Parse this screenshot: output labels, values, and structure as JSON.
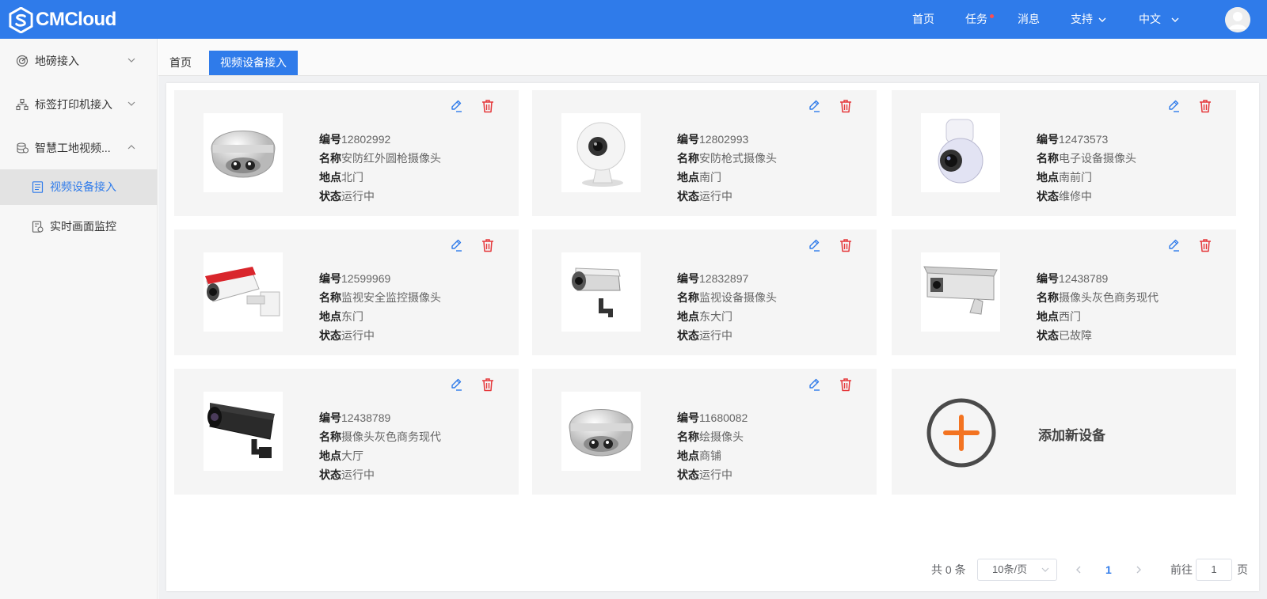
{
  "brand": {
    "name": "CMCloud"
  },
  "topnav": {
    "home": "首页",
    "tasks": "任务",
    "messages": "消息",
    "support": "支持",
    "language": "中文"
  },
  "sidebar": {
    "items": [
      {
        "label": "地磅接入",
        "icon": "radar-icon",
        "expanded": false
      },
      {
        "label": "标签打印机接入",
        "icon": "sitemap-icon",
        "expanded": false
      },
      {
        "label": "智慧工地视频...",
        "icon": "coins-icon",
        "expanded": true
      }
    ],
    "subitems": [
      {
        "label": "视频设备接入",
        "icon": "document-icon",
        "active": true
      },
      {
        "label": "实时画面监控",
        "icon": "monitor-doc-icon",
        "active": false
      }
    ]
  },
  "tabs": [
    {
      "label": "首页",
      "active": false
    },
    {
      "label": "视频设备接入",
      "active": true
    }
  ],
  "field_labels": {
    "id": "编号",
    "name": "名称",
    "location": "地点",
    "status": "状态"
  },
  "devices": [
    {
      "id": "12802992",
      "name": "安防红外圆枪摄像头",
      "location": "北门",
      "status": "运行中",
      "camera": "dome"
    },
    {
      "id": "12802993",
      "name": "安防枪式摄像头",
      "location": "南门",
      "status": "运行中",
      "camera": "webcam"
    },
    {
      "id": "12473573",
      "name": "电子设备摄像头",
      "location": "南前门",
      "status": "维修中",
      "camera": "ptz"
    },
    {
      "id": "12599969",
      "name": "监视安全监控摄像头",
      "location": "东门",
      "status": "运行中",
      "camera": "bullet-red"
    },
    {
      "id": "12832897",
      "name": "监视设备摄像头",
      "location": "东大门",
      "status": "运行中",
      "camera": "bullet-grey"
    },
    {
      "id": "12438789",
      "name": "摄像头灰色商务现代",
      "location": "西门",
      "status": "已故障",
      "camera": "box"
    },
    {
      "id": "12438789",
      "name": "摄像头灰色商务现代",
      "location": "大厅",
      "status": "运行中",
      "camera": "bullet-black"
    },
    {
      "id": "11680082",
      "name": "绘摄像头",
      "location": "商铺",
      "status": "运行中",
      "camera": "dome"
    }
  ],
  "add_device": {
    "label": "添加新设备"
  },
  "pagination": {
    "total_text": "共 0 条",
    "page_size": "10条/页",
    "current_page": "1",
    "goto_prefix": "前往",
    "goto_value": "1",
    "goto_suffix": "页"
  },
  "colors": {
    "primary": "#2f7bea",
    "danger": "#e5383b",
    "add": "#f37321"
  }
}
